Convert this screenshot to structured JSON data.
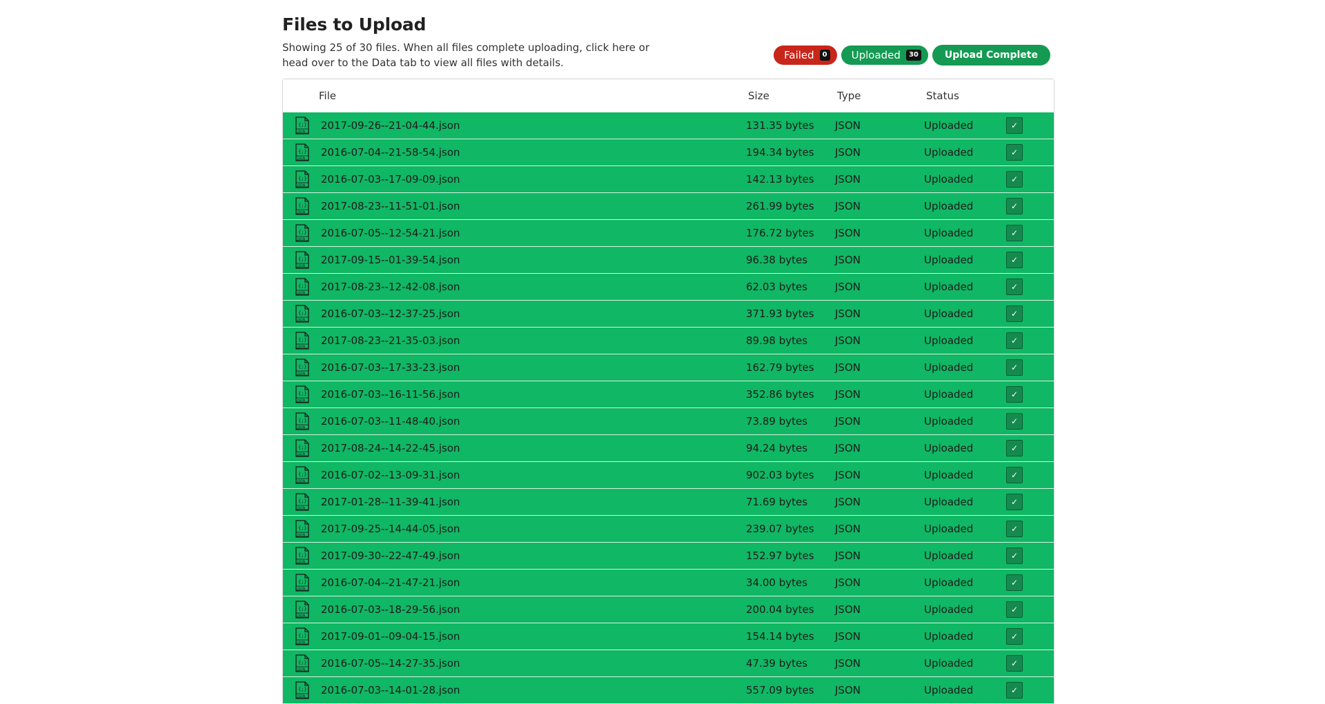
{
  "header": {
    "title": "Files to Upload",
    "description": "Showing 25 of 30 files. When all files complete uploading, click here or head over to the Data tab to view all files with details."
  },
  "badges": {
    "failed_label": "Failed",
    "failed_count": "0",
    "uploaded_label": "Uploaded",
    "uploaded_count": "30",
    "complete_label": "Upload Complete"
  },
  "table": {
    "columns": {
      "file": "File",
      "size": "Size",
      "type": "Type",
      "status": "Status"
    },
    "rows": [
      {
        "file": "2017-09-26--21-04-44.json",
        "size": "131.35 bytes",
        "type": "JSON",
        "status": "Uploaded"
      },
      {
        "file": "2016-07-04--21-58-54.json",
        "size": "194.34 bytes",
        "type": "JSON",
        "status": "Uploaded"
      },
      {
        "file": "2016-07-03--17-09-09.json",
        "size": "142.13 bytes",
        "type": "JSON",
        "status": "Uploaded"
      },
      {
        "file": "2017-08-23--11-51-01.json",
        "size": "261.99 bytes",
        "type": "JSON",
        "status": "Uploaded"
      },
      {
        "file": "2016-07-05--12-54-21.json",
        "size": "176.72 bytes",
        "type": "JSON",
        "status": "Uploaded"
      },
      {
        "file": "2017-09-15--01-39-54.json",
        "size": "96.38 bytes",
        "type": "JSON",
        "status": "Uploaded"
      },
      {
        "file": "2017-08-23--12-42-08.json",
        "size": "62.03 bytes",
        "type": "JSON",
        "status": "Uploaded"
      },
      {
        "file": "2016-07-03--12-37-25.json",
        "size": "371.93 bytes",
        "type": "JSON",
        "status": "Uploaded"
      },
      {
        "file": "2017-08-23--21-35-03.json",
        "size": "89.98 bytes",
        "type": "JSON",
        "status": "Uploaded"
      },
      {
        "file": "2016-07-03--17-33-23.json",
        "size": "162.79 bytes",
        "type": "JSON",
        "status": "Uploaded"
      },
      {
        "file": "2016-07-03--16-11-56.json",
        "size": "352.86 bytes",
        "type": "JSON",
        "status": "Uploaded"
      },
      {
        "file": "2016-07-03--11-48-40.json",
        "size": "73.89 bytes",
        "type": "JSON",
        "status": "Uploaded"
      },
      {
        "file": "2017-08-24--14-22-45.json",
        "size": "94.24 bytes",
        "type": "JSON",
        "status": "Uploaded"
      },
      {
        "file": "2016-07-02--13-09-31.json",
        "size": "902.03 bytes",
        "type": "JSON",
        "status": "Uploaded"
      },
      {
        "file": "2017-01-28--11-39-41.json",
        "size": "71.69 bytes",
        "type": "JSON",
        "status": "Uploaded"
      },
      {
        "file": "2017-09-25--14-44-05.json",
        "size": "239.07 bytes",
        "type": "JSON",
        "status": "Uploaded"
      },
      {
        "file": "2017-09-30--22-47-49.json",
        "size": "152.97 bytes",
        "type": "JSON",
        "status": "Uploaded"
      },
      {
        "file": "2016-07-04--21-47-21.json",
        "size": "34.00 bytes",
        "type": "JSON",
        "status": "Uploaded"
      },
      {
        "file": "2016-07-03--18-29-56.json",
        "size": "200.04 bytes",
        "type": "JSON",
        "status": "Uploaded"
      },
      {
        "file": "2017-09-01--09-04-15.json",
        "size": "154.14 bytes",
        "type": "JSON",
        "status": "Uploaded"
      },
      {
        "file": "2016-07-05--14-27-35.json",
        "size": "47.39 bytes",
        "type": "JSON",
        "status": "Uploaded"
      },
      {
        "file": "2016-07-03--14-01-28.json",
        "size": "557.09 bytes",
        "type": "JSON",
        "status": "Uploaded"
      }
    ],
    "row_icon": "json-file-icon",
    "row_check_icon": "checkmark-icon",
    "row_color": "#10b764"
  },
  "colors": {
    "failed": "#c8261b",
    "uploaded": "#149a52",
    "row_success": "#10b764"
  }
}
